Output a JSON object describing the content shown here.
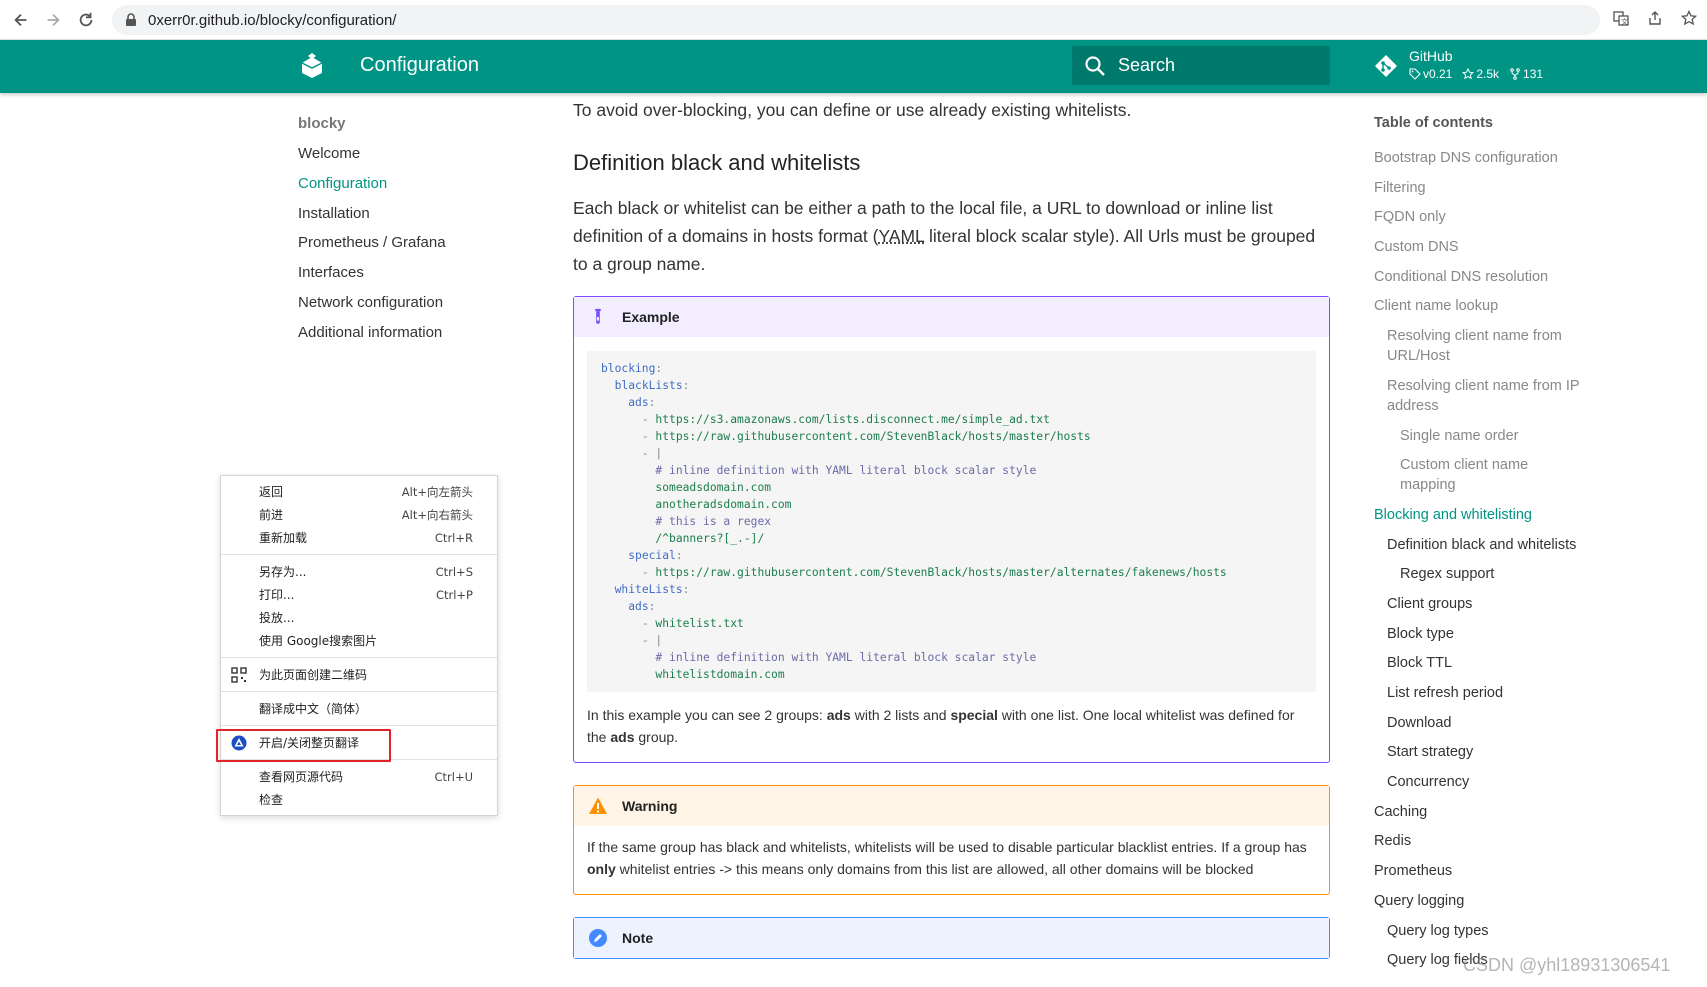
{
  "browser": {
    "url": "0xerr0r.github.io/blocky/configuration/"
  },
  "header": {
    "title": "Configuration",
    "search_placeholder": "Search",
    "repo_name": "GitHub",
    "repo_version": "v0.21",
    "repo_stars": "2.5k",
    "repo_forks": "131"
  },
  "leftnav": {
    "head": "blocky",
    "items": [
      "Welcome",
      "Configuration",
      "Installation",
      "Prometheus / Grafana",
      "Interfaces",
      "Network configuration",
      "Additional information"
    ]
  },
  "content": {
    "intro": "To avoid over-blocking, you can define or use already existing whitelists.",
    "heading": "Definition black and whitelists",
    "para_1": "Each black or whitelist can be either a path to the local file, a URL to download or inline list definition of a domains in hosts format (",
    "para_abbr": "YAML",
    "para_2": " literal block scalar style). All Urls must be grouped to a group name.",
    "example": {
      "title": "Example",
      "code": {
        "l1": "blocking",
        "l2": "blackLists",
        "l3": "ads",
        "l4": "https://s3.amazonaws.com/lists.disconnect.me/simple_ad.txt",
        "l5": "https://raw.githubusercontent.com/StevenBlack/hosts/master/hosts",
        "l7": "# inline definition with YAML literal block scalar style",
        "l8": "someadsdomain.com",
        "l9": "anotheradsdomain.com",
        "l10": "# this is a regex",
        "l11": "/^banners?[_.-]/",
        "l12": "special",
        "l13": "https://raw.githubusercontent.com/StevenBlack/hosts/master/alternates/fakenews/hosts",
        "l14": "whiteLists",
        "l15": "ads",
        "l16": "whitelist.txt",
        "l18": "# inline definition with YAML literal block scalar style",
        "l19": "whitelistdomain.com"
      },
      "text_1": "In this example you can see 2 groups: ",
      "bold_1": "ads",
      "text_2": " with 2 lists and ",
      "bold_2": "special",
      "text_3": " with one list. One local whitelist was defined for the ",
      "bold_3": "ads",
      "text_4": " group."
    },
    "warning": {
      "title": "Warning",
      "text_1": "If the same group has black and whitelists, whitelists will be used to disable particular blacklist entries. If a group has ",
      "bold": "only",
      "text_2": " whitelist entries -> this means only domains from this list are allowed, all other domains will be blocked"
    },
    "note": {
      "title": "Note"
    }
  },
  "toc": {
    "title": "Table of contents",
    "items": [
      "Bootstrap DNS configuration",
      "Filtering",
      "FQDN only",
      "Custom DNS",
      "Conditional DNS resolution",
      "Client name lookup",
      "Resolving client name from URL/Host",
      "Resolving client name from IP address",
      "Single name order",
      "Custom client name mapping",
      "Blocking and whitelisting",
      "Definition black and whitelists",
      "Regex support",
      "Client groups",
      "Block type",
      "Block TTL",
      "List refresh period",
      "Download",
      "Start strategy",
      "Concurrency",
      "Caching",
      "Redis",
      "Prometheus",
      "Query logging",
      "Query log types",
      "Query log fields"
    ]
  },
  "context_menu": {
    "back": "返回",
    "back_sc": "Alt+向左箭头",
    "forward": "前进",
    "forward_sc": "Alt+向右箭头",
    "reload": "重新加载",
    "reload_sc": "Ctrl+R",
    "save_as": "另存为...",
    "save_as_sc": "Ctrl+S",
    "print": "打印...",
    "print_sc": "Ctrl+P",
    "cast": "投放...",
    "search_image": "使用 Google搜索图片",
    "qr_code": "为此页面创建二维码",
    "translate": "翻译成中文（简体）",
    "toggle_translate": "开启/关闭整页翻译",
    "view_source": "查看网页源代码",
    "view_source_sc": "Ctrl+U",
    "inspect": "检查"
  },
  "watermark": "CSDN @yhl18931306541",
  "colors": {
    "primary": "#009485",
    "example": "#7c4dff",
    "warning": "#ff9100",
    "note": "#448aff",
    "highlight": "#e0242b"
  }
}
